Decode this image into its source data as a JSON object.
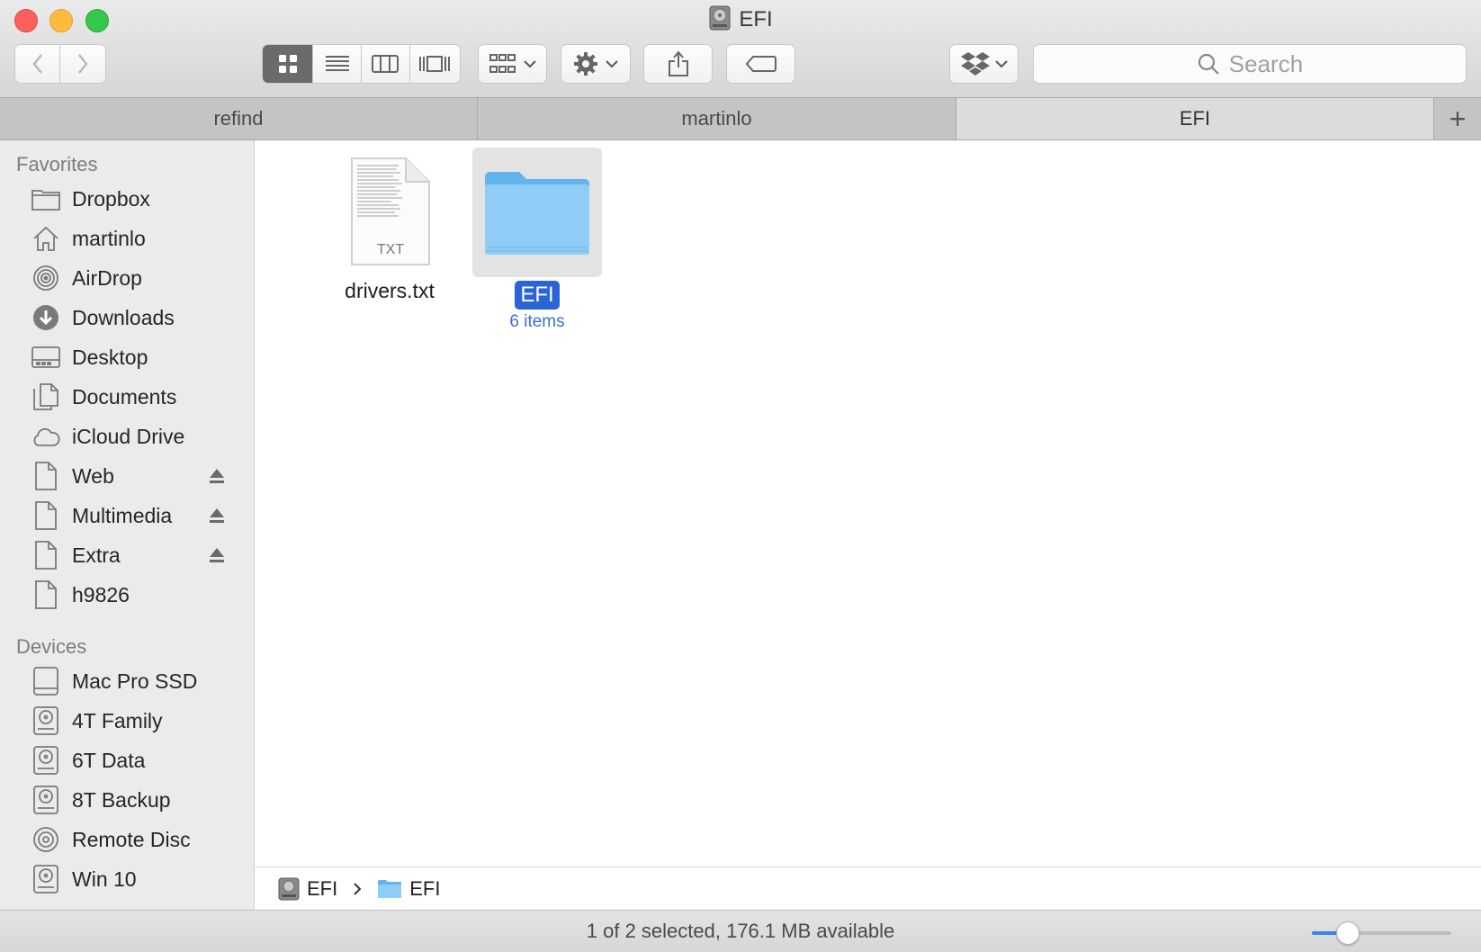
{
  "window": {
    "title": "EFI"
  },
  "toolbar": {
    "back_icon": "chevron-left-icon",
    "forward_icon": "chevron-right-icon",
    "view_modes": [
      "icon-view-icon",
      "list-view-icon",
      "column-view-icon",
      "cover-flow-icon"
    ],
    "active_view": "icon-view-icon",
    "search_placeholder": "Search"
  },
  "tabs": [
    {
      "label": "refind",
      "active": false
    },
    {
      "label": "martinlo",
      "active": false
    },
    {
      "label": "EFI",
      "active": true
    }
  ],
  "sidebar": {
    "favorites_header": "Favorites",
    "favorites": [
      {
        "label": "Dropbox",
        "icon": "folder-icon"
      },
      {
        "label": "martinlo",
        "icon": "home-icon"
      },
      {
        "label": "AirDrop",
        "icon": "airdrop-icon"
      },
      {
        "label": "Downloads",
        "icon": "downloads-icon"
      },
      {
        "label": "Desktop",
        "icon": "desktop-icon"
      },
      {
        "label": "Documents",
        "icon": "documents-icon"
      },
      {
        "label": "iCloud Drive",
        "icon": "cloud-icon"
      },
      {
        "label": "Web",
        "icon": "file-icon",
        "eject": true
      },
      {
        "label": "Multimedia",
        "icon": "file-icon",
        "eject": true
      },
      {
        "label": "Extra",
        "icon": "file-icon",
        "eject": true
      },
      {
        "label": "h9826",
        "icon": "file-icon"
      }
    ],
    "devices_header": "Devices",
    "devices": [
      {
        "label": "Mac Pro SSD",
        "icon": "ssd-icon"
      },
      {
        "label": "4T Family",
        "icon": "hard-drive-icon"
      },
      {
        "label": "6T Data",
        "icon": "hard-drive-icon"
      },
      {
        "label": "8T Backup",
        "icon": "hard-drive-icon"
      },
      {
        "label": "Remote Disc",
        "icon": "disc-icon"
      },
      {
        "label": "Win 10",
        "icon": "hard-drive-icon"
      }
    ]
  },
  "files": [
    {
      "name": "drivers.txt",
      "type_label": "TXT",
      "icon": "text-file-icon",
      "selected": false
    },
    {
      "name": "EFI",
      "subtitle": "6 items",
      "icon": "folder-icon",
      "selected": true
    }
  ],
  "pathbar": [
    {
      "label": "EFI",
      "icon": "hard-drive-icon"
    },
    {
      "label": "EFI",
      "icon": "folder-icon"
    }
  ],
  "status": {
    "text": "1 of 2 selected, 176.1 MB available",
    "icon_size_level": 0.25
  },
  "colors": {
    "selection": "#2a64d6",
    "folder": "#7fc4f5",
    "accent": "#3b82f6"
  }
}
